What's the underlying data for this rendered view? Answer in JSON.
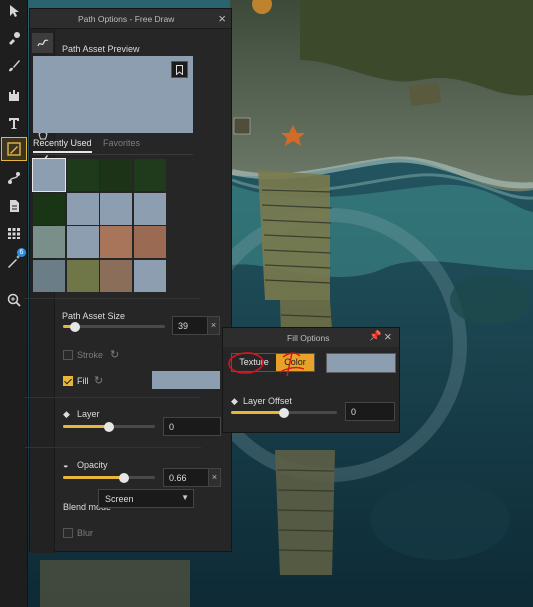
{
  "path_options": {
    "title": "Path Options - Free Draw",
    "preview_heading": "Path Asset Preview",
    "tabs": [
      "Recently Used",
      "Favorites"
    ],
    "preview_color": "#8d9eb0",
    "asset_size_label": "Path Asset Size",
    "asset_size_value": "39",
    "asset_size_level": 0.12,
    "clear_glyph": "×",
    "stroke_label": "Stroke",
    "stroke_checked": false,
    "fill_label": "Fill",
    "fill_checked": true,
    "fill_color": "#8d9eb0",
    "layer_label": "Layer",
    "layer_value": "0",
    "layer_level": 0.5,
    "opacity_label": "Opacity",
    "opacity_value": "0.66",
    "opacity_level": 0.66,
    "blend_label": "Blend mode",
    "blend_value": "Screen",
    "blur_label": "Blur",
    "blur_checked": false
  },
  "fill_options": {
    "title": "Fill Options",
    "mode_texture": "Texture",
    "mode_color": "Color",
    "selected_mode": "Color",
    "color_value": "#8d9eb0",
    "layer_offset_label": "Layer Offset",
    "layer_offset_value": "0",
    "layer_offset_level": 0.5
  },
  "toolbar": {
    "tools": [
      "select-icon",
      "brush-stamp-icon",
      "paint-brush-icon",
      "castle-icon",
      "text-icon",
      "path-tool-icon",
      "node-icon",
      "document-icon",
      "grid-icon",
      "magic-wand-icon",
      "zoom-icon"
    ],
    "active_tool": "path-tool-icon",
    "wand_badge": "6"
  },
  "accent_color": "#e8b63a"
}
